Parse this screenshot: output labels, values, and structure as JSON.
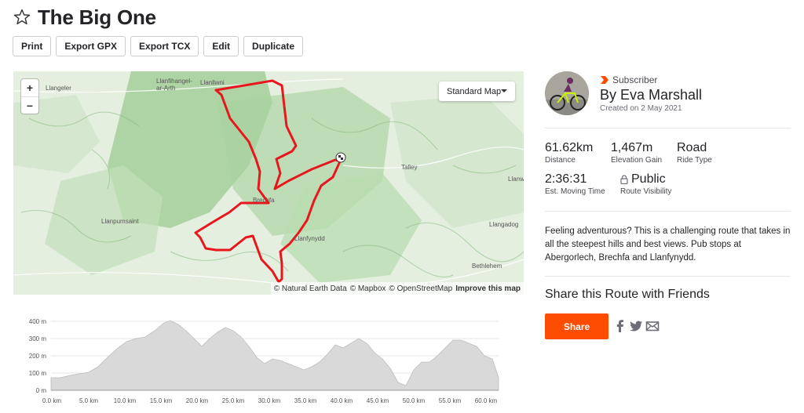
{
  "page": {
    "title": "The Big One"
  },
  "toolbar": {
    "print": "Print",
    "export_gpx": "Export GPX",
    "export_tcx": "Export TCX",
    "edit": "Edit",
    "duplicate": "Duplicate"
  },
  "map": {
    "zoom_in": "+",
    "zoom_out": "−",
    "style_select": "Standard Map",
    "attribution": [
      "© Natural Earth Data",
      "© Mapbox",
      "© OpenStreetMap"
    ],
    "improve": "Improve this map",
    "places": [
      "Llangeler",
      "Llanfihangel-ar-Arth",
      "Llanllwni",
      "Talley",
      "Llanwr",
      "Brechfa",
      "Llanpumsaint",
      "Llanfynydd",
      "Llangadog",
      "Bethlehem"
    ],
    "route_color": "#e8171d"
  },
  "elevation": {
    "y_ticks": [
      "400 m",
      "300 m",
      "200 m",
      "100 m",
      "0 m"
    ],
    "x_ticks": [
      "0.0 km",
      "5.0 km",
      "10.0 km",
      "15.0 km",
      "20.0 km",
      "25.0 km",
      "30.0 km",
      "35.0 km",
      "40.0 km",
      "45.0 km",
      "50.0 km",
      "55.0 km",
      "60.0 km"
    ],
    "fill_color": "#d9d9d9"
  },
  "athlete": {
    "badge": "Subscriber",
    "name": "By Eva Marshall",
    "created": "Created on 2 May 2021"
  },
  "stats": {
    "distance_value": "61.62km",
    "distance_label": "Distance",
    "elev_value": "1,467m",
    "elev_label": "Elevation Gain",
    "type_value": "Road",
    "type_label": "Ride Type",
    "time_value": "2:36:31",
    "time_label": "Est. Moving Time",
    "visibility_value": "Public",
    "visibility_label": "Route Visibility"
  },
  "description": "Feeling adventurous? This is a challenging route that takes in all the steepest hills and best views. Pub stops at Abergorlech, Brechfa and Llanfynydd.",
  "share": {
    "title": "Share this Route with Friends",
    "button": "Share"
  },
  "colors": {
    "accent": "#fc4c02"
  },
  "icons": [
    "star-icon",
    "subscriber-chevron-icon",
    "lock-icon",
    "facebook-icon",
    "twitter-icon",
    "email-icon",
    "finish-flag-icon",
    "caret-down-icon"
  ]
}
